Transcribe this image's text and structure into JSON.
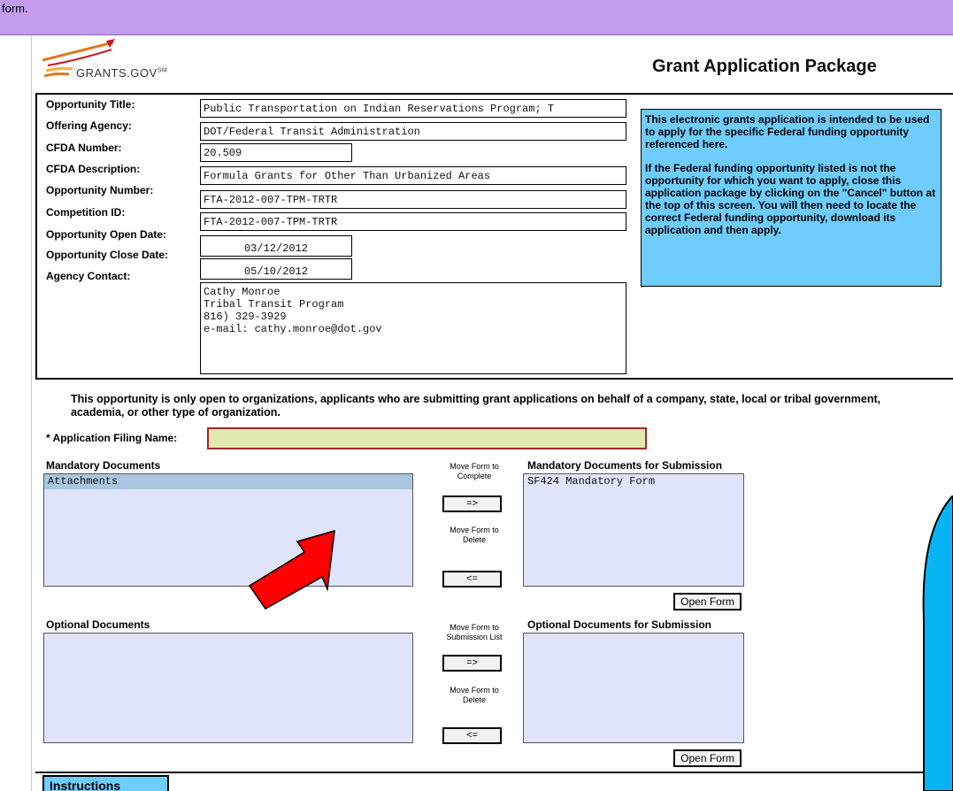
{
  "window": {
    "title_fragment": "form."
  },
  "header": {
    "logo_text": "GRANTS.GOV",
    "logo_mark": "SM",
    "package_title": "Grant Application Package"
  },
  "fields": [
    {
      "label": "Opportunity Title:",
      "value": "Public Transportation on Indian Reservations Program; T"
    },
    {
      "label": "Offering Agency:",
      "value": "DOT/Federal Transit Administration"
    },
    {
      "label": "CFDA Number:",
      "value": "20.509"
    },
    {
      "label": "CFDA Description:",
      "value": "Formula Grants for Other Than Urbanized Areas"
    },
    {
      "label": "Opportunity Number:",
      "value": "FTA-2012-007-TPM-TRTR"
    },
    {
      "label": "Competition ID:",
      "value": "FTA-2012-007-TPM-TRTR"
    },
    {
      "label": "Opportunity Open Date:",
      "value": "03/12/2012"
    },
    {
      "label": "Opportunity Close Date:",
      "value": "05/10/2012"
    },
    {
      "label": "Agency Contact:",
      "value": "Cathy Monroe\nTribal Transit Program\n816) 329-3929\ne-mail: cathy.monroe@dot.gov"
    }
  ],
  "info_box": {
    "paragraph1": "This electronic grants application is intended to be used to apply for the specific Federal funding opportunity referenced here.",
    "paragraph2": "If the Federal funding opportunity listed is not the opportunity for which you want to apply, close this application package by clicking on the \"Cancel\" button at the top of this screen. You will  then need to locate the correct Federal funding opportunity, download its application and then apply."
  },
  "notice": "This opportunity is only open to organizations, applicants who are submitting grant applications on behalf of a company, state, local or tribal government, academia, or other type of organization.",
  "filing": {
    "label": "* Application Filing Name:",
    "value": ""
  },
  "mandatory": {
    "left_title": "Mandatory Documents",
    "left_items": [
      "Attachments"
    ],
    "right_title": "Mandatory Documents for Submission",
    "right_items": [
      "SF424 Mandatory Form"
    ],
    "move_complete_label": "Move Form to Complete",
    "move_delete_label": "Move Form to Delete",
    "add_button": "=>",
    "remove_button": "<=",
    "open_form_button": "Open Form"
  },
  "optional": {
    "left_title": "Optional Documents",
    "left_items": [],
    "right_title": "Optional Documents for Submission",
    "right_items": [],
    "move_submission_label": "Move Form to Submission List",
    "move_delete_label": "Move Form to Delete",
    "add_button": "=>",
    "remove_button": "<=",
    "open_form_button": "Open Form"
  },
  "instructions_tab": "Instructions",
  "colors": {
    "topbar": "#c39cef",
    "info_box": "#6fccff",
    "filing_input": "#e1e9b1",
    "listbox": "#dfe4fb",
    "arrow": "#ff0000"
  }
}
